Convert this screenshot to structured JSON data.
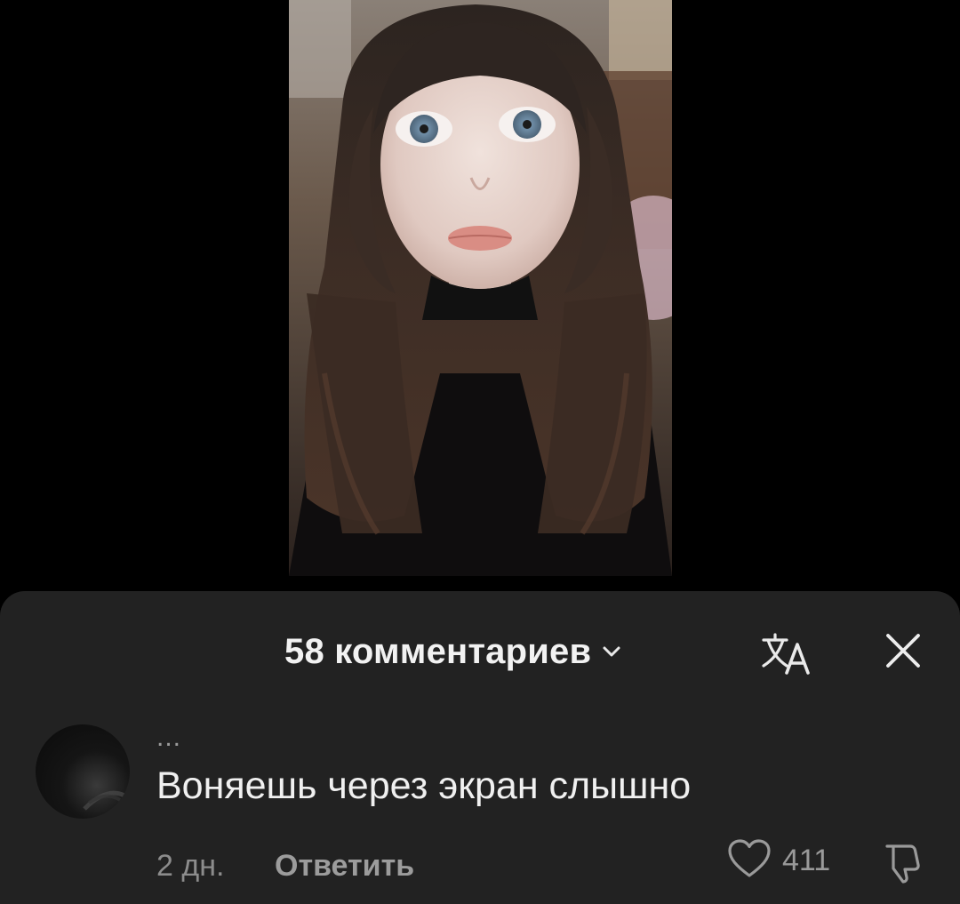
{
  "video": {
    "description_icon": "video-preview"
  },
  "comments_sheet": {
    "count_label": "58 комментариев",
    "chevron_icon": "chevron-down-icon",
    "translate_icon": "translate-icon",
    "close_icon": "close-icon"
  },
  "comment": {
    "username": "...",
    "text": "Воняешь через экран слышно",
    "time": "2 дн.",
    "reply_label": "Ответить",
    "like_count": "411",
    "like_icon": "heart-icon",
    "dislike_icon": "thumbs-down-icon"
  },
  "colors": {
    "sheet_bg": "#222222",
    "page_bg": "#000000",
    "primary_text": "#f0f0f0",
    "secondary_text": "#8c8c8c"
  }
}
